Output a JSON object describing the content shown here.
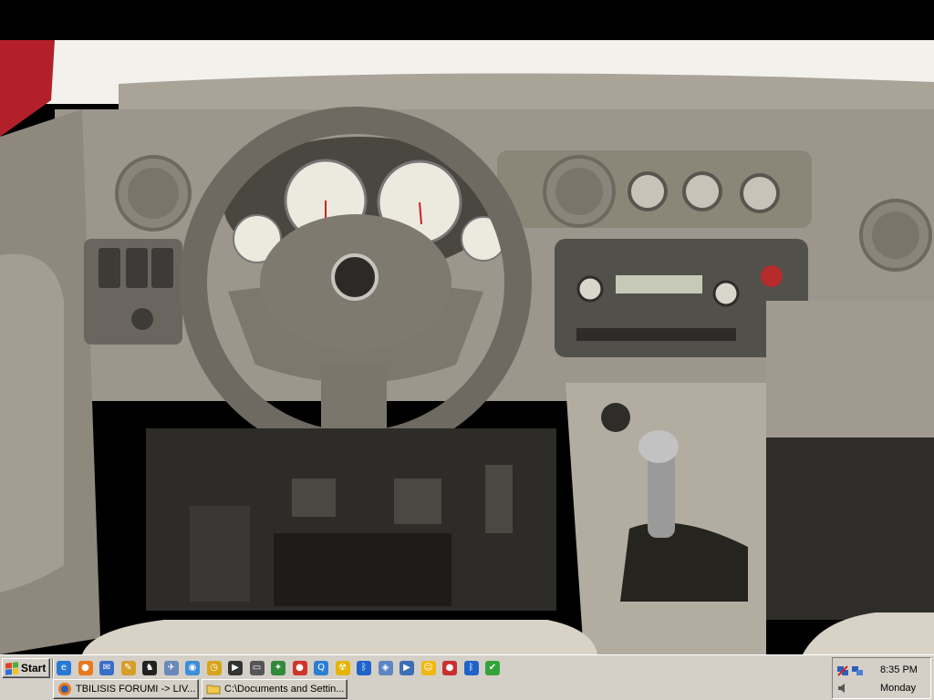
{
  "taskbar": {
    "start_label": "Start",
    "quick_launch": [
      {
        "icon": "ie-icon",
        "glyph": "e",
        "color": "#2a78d6"
      },
      {
        "icon": "firefox-icon",
        "glyph": "●",
        "color": "#e87a1d"
      },
      {
        "icon": "outlook-icon",
        "glyph": "✉",
        "color": "#3a6fc9"
      },
      {
        "icon": "tools-icon",
        "glyph": "✎",
        "color": "#d59f2a"
      },
      {
        "icon": "counter-strike-icon",
        "glyph": "♞",
        "color": "#222222"
      },
      {
        "icon": "airplane-icon",
        "glyph": "✈",
        "color": "#6a88b8"
      },
      {
        "icon": "globe-icon",
        "glyph": "◉",
        "color": "#3c8fd8"
      },
      {
        "icon": "clock-icon",
        "glyph": "◷",
        "color": "#d8a41c"
      },
      {
        "icon": "media-icon",
        "glyph": "▶",
        "color": "#333333"
      },
      {
        "icon": "drive-icon",
        "glyph": "▭",
        "color": "#555555"
      },
      {
        "icon": "game-icon",
        "glyph": "✦",
        "color": "#2f8a3c"
      },
      {
        "icon": "tomato-icon",
        "glyph": "●",
        "color": "#d0352a"
      },
      {
        "icon": "search-icon",
        "glyph": "Q",
        "color": "#2b7fcf"
      },
      {
        "icon": "radiation-icon",
        "glyph": "☢",
        "color": "#e6b400"
      },
      {
        "icon": "bluetooth-icon",
        "glyph": "ᛒ",
        "color": "#1f63c9"
      },
      {
        "icon": "shield-icon",
        "glyph": "◈",
        "color": "#5d85c2"
      },
      {
        "icon": "play-icon",
        "glyph": "▶",
        "color": "#3b6fb5"
      },
      {
        "icon": "smiley-icon",
        "glyph": "☺",
        "color": "#f2b70e"
      },
      {
        "icon": "record-icon",
        "glyph": "●",
        "color": "#c92f2f"
      },
      {
        "icon": "bluetooth-icon",
        "glyph": "ᛒ",
        "color": "#1f63c9"
      },
      {
        "icon": "checkmark-icon",
        "glyph": "✔",
        "color": "#34a33a"
      }
    ],
    "tasks": [
      {
        "label": "TBILISIS FORUMI -> LIV..."
      },
      {
        "label": "C:\\Documents and Settin..."
      }
    ],
    "tray": {
      "time": "8:35 PM",
      "day": "Monday"
    }
  }
}
